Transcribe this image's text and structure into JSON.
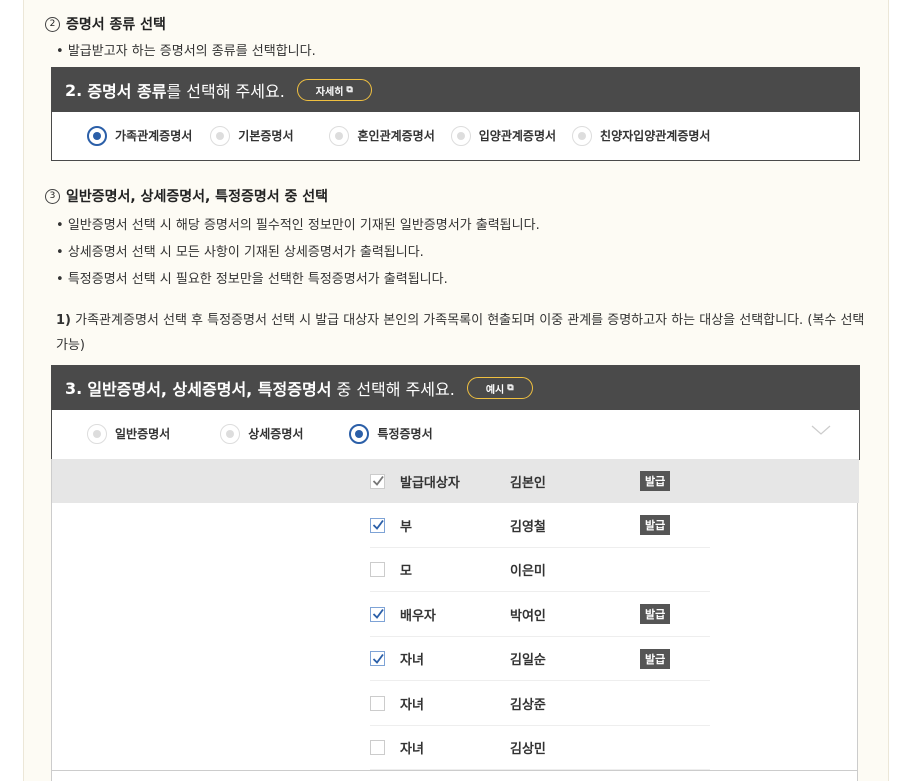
{
  "step2": {
    "num": "2",
    "title": "증명서 종류 선택",
    "desc": "발급받고자 하는 증명서의 종류를 선택합니다.",
    "box_title_num": "2.",
    "box_title_bold": "증명서 종류",
    "box_title_rest": "를 선택해 주세요.",
    "detail_btn": "자세히",
    "options": [
      "가족관계증명서",
      "기본증명서",
      "혼인관계증명서",
      "입양관계증명서",
      "친양자입양관계증명서"
    ],
    "selected": 0
  },
  "step3": {
    "num": "3",
    "title": "일반증명서, 상세증명서, 특정증명서 중 선택",
    "bullets": [
      "일반증명서 선택 시 해당 증명서의 필수적인 정보만이 기재된 일반증명서가 출력됩니다.",
      "상세증명서 선택 시 모든 사항이 기재된 상세증명서가 출력됩니다.",
      "특정증명서 선택 시 필요한 정보만을 선택한 특정증명서가 출력됩니다."
    ],
    "note_num": "1)",
    "note": "가족관계증명서 선택 후 특정증명서 선택 시 발급 대상자 본인의 가족목록이 현출되며 이중 관계를 증명하고자 하는 대상을 선택합니다. (복수 선택 가능)",
    "box_title_num": "3.",
    "box_title_bold": "일반증명서, 상세증명서, 특정증명서",
    "box_title_rest": "중 선택해 주세요.",
    "example_btn": "예시",
    "options": [
      "일반증명서",
      "상세증명서",
      "특정증명서"
    ],
    "selected": 2
  },
  "family": [
    {
      "rel": "발급대상자",
      "name": "김본인",
      "checked": true,
      "tag": "발급",
      "disabled": true
    },
    {
      "rel": "부",
      "name": "김영철",
      "checked": true,
      "tag": "발급"
    },
    {
      "rel": "모",
      "name": "이은미",
      "checked": false,
      "tag": ""
    },
    {
      "rel": "배우자",
      "name": "박여인",
      "checked": true,
      "tag": "발급"
    },
    {
      "rel": "자녀",
      "name": "김일순",
      "checked": true,
      "tag": "발급"
    },
    {
      "rel": "자녀",
      "name": "김상준",
      "checked": false,
      "tag": ""
    },
    {
      "rel": "자녀",
      "name": "김상민",
      "checked": false,
      "tag": ""
    }
  ]
}
